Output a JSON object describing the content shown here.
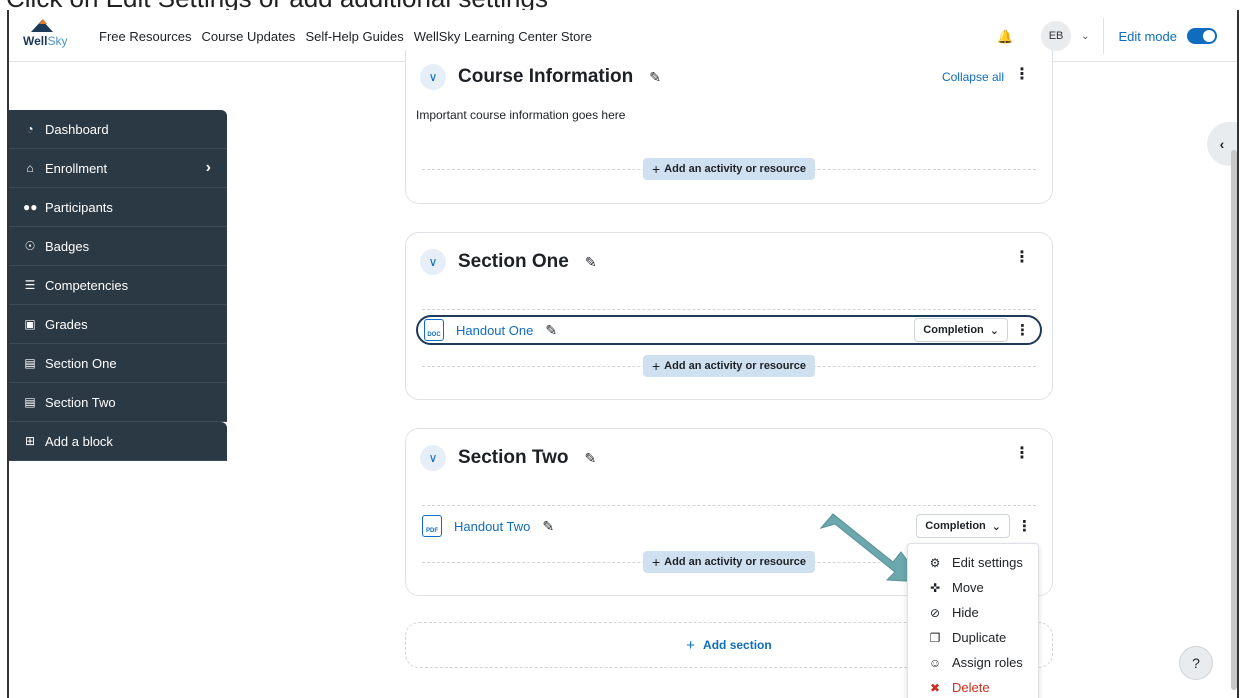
{
  "caption": "Click on Edit Settings or add additional settings",
  "navbar": {
    "logo_text_a": "Well",
    "logo_text_b": "Sky",
    "links": [
      "Free Resources",
      "Course Updates",
      "Self-Help Guides",
      "WellSky Learning Center Store"
    ],
    "avatar_initials": "EB",
    "edit_mode_label": "Edit mode",
    "edit_mode_on": true
  },
  "drawer": {
    "items": [
      {
        "label": "Dashboard",
        "icon": "gauge-icon"
      },
      {
        "label": "Enrollment",
        "icon": "bank-icon"
      },
      {
        "label": "Participants",
        "icon": "users-icon"
      },
      {
        "label": "Badges",
        "icon": "badge-icon"
      },
      {
        "label": "Competencies",
        "icon": "list-check-icon"
      },
      {
        "label": "Grades",
        "icon": "grades-icon"
      },
      {
        "label": "Section One",
        "icon": "list-box-icon"
      },
      {
        "label": "Section Two",
        "icon": "list-box-icon"
      },
      {
        "label": "Add a block",
        "icon": "plus-square-icon"
      }
    ]
  },
  "sections": {
    "course_info": {
      "title": "Course Information",
      "collapse_all": "Collapse all",
      "description": "Important course information goes here",
      "add_label": "Add an activity or resource"
    },
    "one": {
      "title": "Section One",
      "activity": "Handout One",
      "activity_type": "DOC",
      "completion": "Completion",
      "add_label": "Add an activity or resource"
    },
    "two": {
      "title": "Section Two",
      "activity": "Handout Two",
      "activity_type": "PDF",
      "completion": "Completion",
      "add_label": "Add an activity or resource"
    }
  },
  "add_section_label": "Add section",
  "menu": {
    "items": [
      {
        "label": "Edit settings",
        "icon": "gear-icon"
      },
      {
        "label": "Move",
        "icon": "move-icon"
      },
      {
        "label": "Hide",
        "icon": "eye-slash-icon"
      },
      {
        "label": "Duplicate",
        "icon": "copy-icon"
      },
      {
        "label": "Assign roles",
        "icon": "user-roles-icon"
      },
      {
        "label": "Delete",
        "icon": "trash-icon"
      }
    ]
  },
  "help_label": "?",
  "colors": {
    "accent": "#0f6cbf",
    "drawer_bg": "#2b3944",
    "callout_arrow": "#6aa8ad",
    "danger": "#ca3120"
  }
}
